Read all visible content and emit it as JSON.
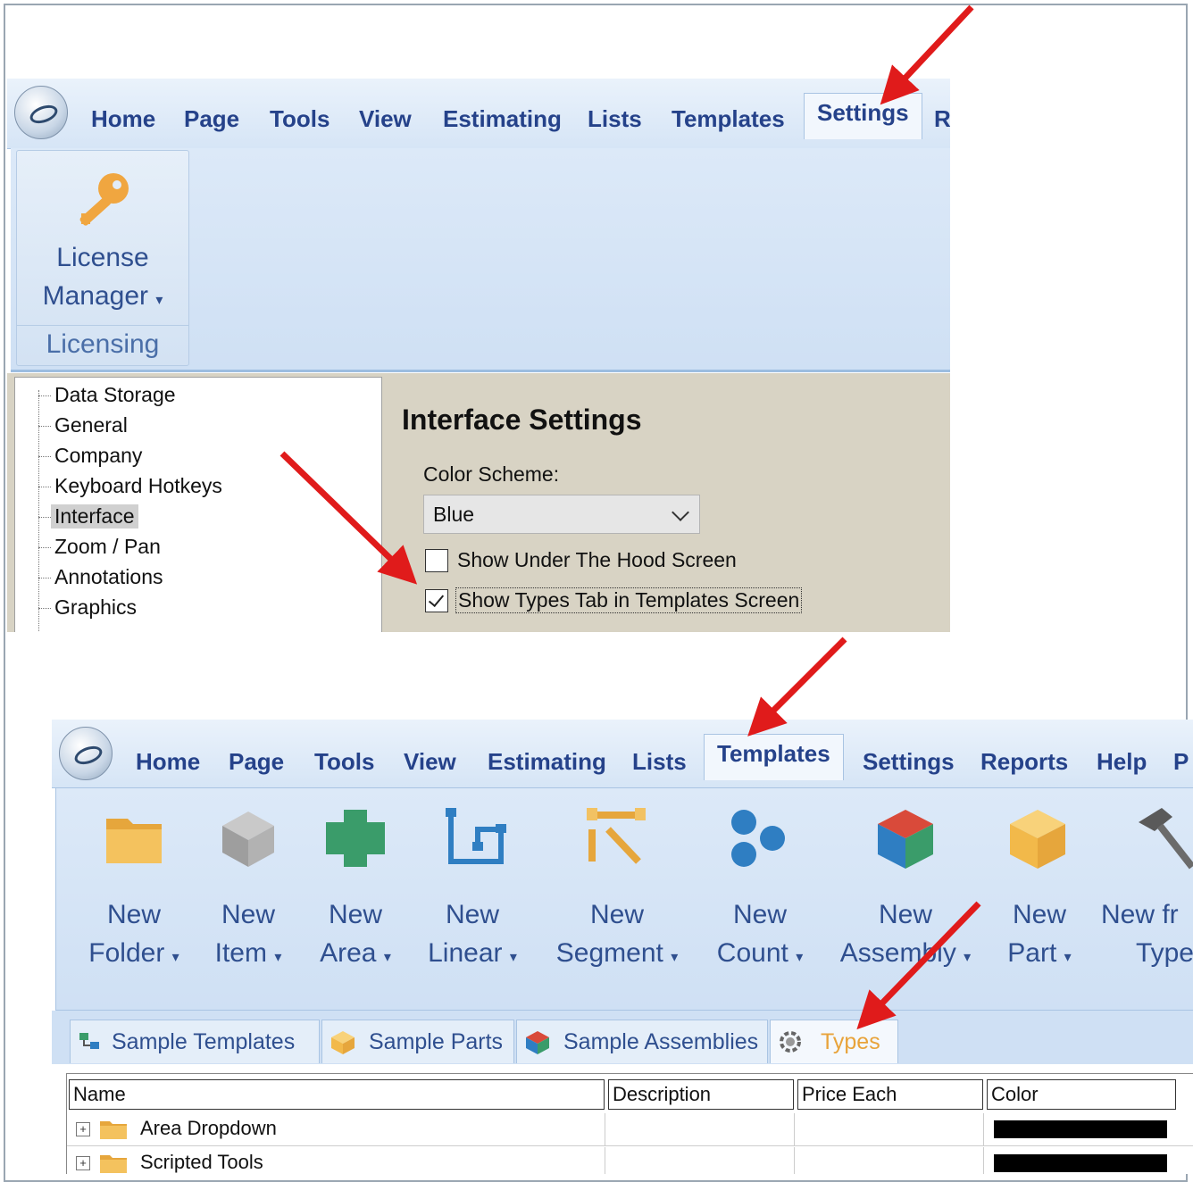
{
  "top": {
    "tabs": [
      "Home",
      "Page",
      "Tools",
      "View",
      "Estimating",
      "Lists",
      "Templates",
      "Settings",
      "R"
    ],
    "active_tab": "Settings",
    "license_button": {
      "line1": "License",
      "line2": "Manager"
    },
    "group_label": "Licensing",
    "tree": [
      "Data Storage",
      "General",
      "Company",
      "Keyboard Hotkeys",
      "Interface",
      "Zoom / Pan",
      "Annotations",
      "Graphics"
    ],
    "selected_tree_item": "Interface",
    "panel_title": "Interface Settings",
    "color_scheme_label": "Color Scheme:",
    "color_scheme_value": "Blue",
    "checkbox1": "Show Under The Hood Screen",
    "checkbox1_checked": false,
    "checkbox2": "Show Types Tab in Templates Screen",
    "checkbox2_checked": true
  },
  "bottom": {
    "tabs": [
      "Home",
      "Page",
      "Tools",
      "View",
      "Estimating",
      "Lists",
      "Templates",
      "Settings",
      "Reports",
      "Help",
      "P"
    ],
    "active_tab": "Templates",
    "buttons": [
      {
        "line1": "New",
        "line2": "Folder",
        "icon": "folder-icon"
      },
      {
        "line1": "New",
        "line2": "Item",
        "icon": "gray-cube-icon"
      },
      {
        "line1": "New",
        "line2": "Area",
        "icon": "area-icon"
      },
      {
        "line1": "New",
        "line2": "Linear",
        "icon": "linear-icon"
      },
      {
        "line1": "New",
        "line2": "Segment",
        "icon": "segment-icon"
      },
      {
        "line1": "New",
        "line2": "Count",
        "icon": "count-icon"
      },
      {
        "line1": "New",
        "line2": "Assembly",
        "icon": "color-cube-icon"
      },
      {
        "line1": "New",
        "line2": "Part",
        "icon": "orange-cube-icon"
      },
      {
        "line1": "New fr",
        "line2": "Type",
        "icon": "hammer-icon"
      }
    ],
    "doc_tabs": [
      "Sample Templates",
      "Sample Parts",
      "Sample Assemblies",
      "Types"
    ],
    "active_doc_tab": "Types",
    "columns": [
      "Name",
      "Description",
      "Price Each",
      "Color"
    ],
    "rows": [
      {
        "name": "Area Dropdown",
        "color": "#000000"
      },
      {
        "name": "Scripted Tools",
        "color": "#000000"
      }
    ]
  },
  "colors": {
    "arrow": "#e01b1b",
    "ribbon_text": "#25428a",
    "types_tab_text": "#e8a33a"
  }
}
